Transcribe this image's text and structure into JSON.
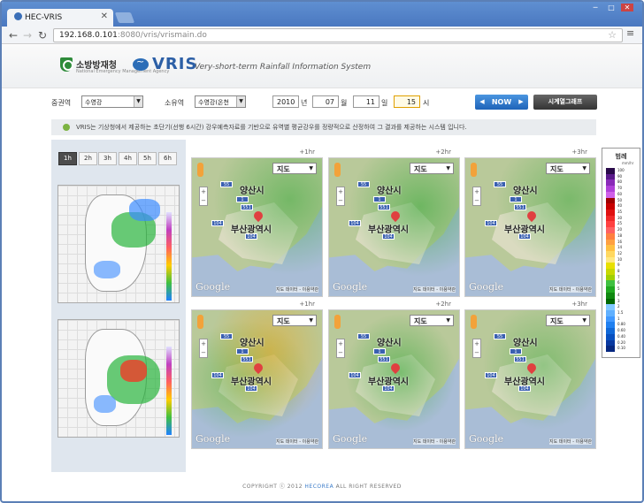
{
  "browser": {
    "tab_title": "HEC-VRIS",
    "url_host": "192.168.0.101",
    "url_rest": ":8080/vris/vrismain.do",
    "window_controls": [
      "─",
      "□",
      "✕"
    ]
  },
  "header": {
    "org_name": "소방방재청",
    "org_sub": "National Emergency Management Agency",
    "app_name": "VRIS",
    "app_subtitle": "Very-short-term Rainfall Information System"
  },
  "controls": {
    "basin_label": "중권역",
    "basin_value": "수영강",
    "subbasin_label": "소유역",
    "subbasin_value": "수영강(온천",
    "year": "2010",
    "year_unit": "년",
    "month": "07",
    "month_unit": "월",
    "day": "11",
    "day_unit": "일",
    "hour": "15",
    "hour_unit": "시",
    "now_button": "NOW",
    "graph_button": "시계열그래프"
  },
  "notice": "VRIS는 기상청에서 제공하는 초단기(선행 6시간) 강우예측자료를 기반으로 유역별 평균강우를 정량적으로 산정하여 그 결과를 제공하는 시스템 입니다.",
  "hour_tabs": [
    "1h",
    "2h",
    "3h",
    "4h",
    "5h",
    "6h"
  ],
  "maps": {
    "time_labels": [
      "+1hr",
      "+2hr",
      "+3hr",
      "+1hr",
      "+2hr",
      "+3hr"
    ],
    "map_type": "지도",
    "city_north": "양산시",
    "city_main": "부산광역시",
    "terms": "지도 데이터 - 이용약관",
    "google": "Google",
    "route_numbers": [
      "55",
      "1",
      "551",
      "104",
      "104"
    ]
  },
  "legend": {
    "title": "범례",
    "unit": "mm/hr",
    "values": [
      "100",
      "90",
      "80",
      "70",
      "60",
      "50",
      "40",
      "35",
      "30",
      "25",
      "20",
      "18",
      "16",
      "14",
      "12",
      "10",
      "9",
      "8",
      "7",
      "6",
      "5",
      "4",
      "3",
      "2",
      "1.5",
      "1",
      "0.80",
      "0.60",
      "0.40",
      "0.20",
      "0.10"
    ],
    "colors": [
      "#2a0a4a",
      "#5a1a8a",
      "#8a2ab8",
      "#b040d8",
      "#d060e8",
      "#a00000",
      "#c80000",
      "#e01010",
      "#f02828",
      "#ff4040",
      "#ff6060",
      "#ff8040",
      "#ffa040",
      "#ffc040",
      "#ffd860",
      "#ffe880",
      "#e8e000",
      "#c8d800",
      "#a0d000",
      "#40c040",
      "#20a820",
      "#108810",
      "#006800",
      "#80c8ff",
      "#60b0ff",
      "#4098ff",
      "#2080f0",
      "#1068d8",
      "#0850c0",
      "#0838a0",
      "#062880"
    ]
  },
  "footer": {
    "prefix": "COPYRIGHT ⓒ 2012 ",
    "brand": "HECOREA",
    "suffix": " ALL RIGHT RESERVED"
  }
}
